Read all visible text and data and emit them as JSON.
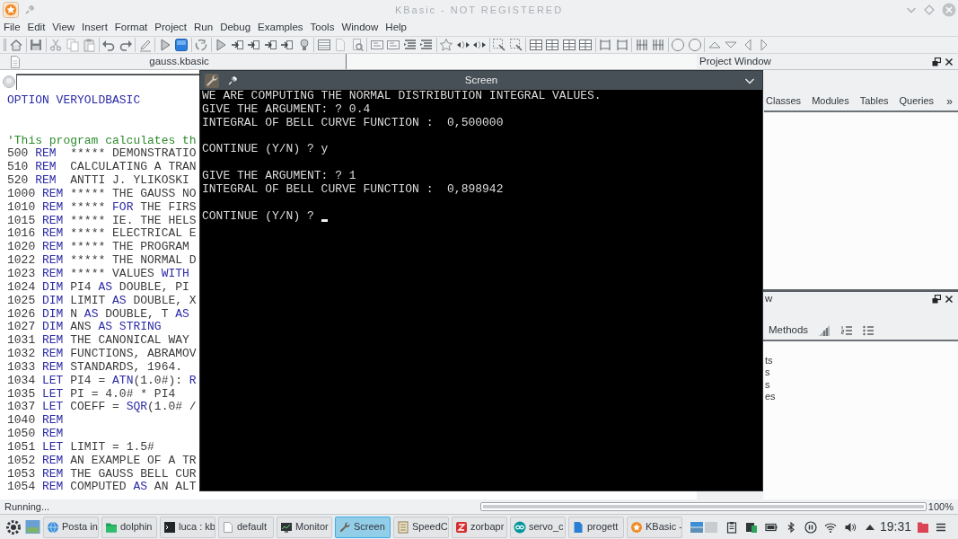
{
  "window": {
    "title": "KBasic - NOT REGISTERED"
  },
  "menu": [
    "File",
    "Edit",
    "View",
    "Insert",
    "Format",
    "Project",
    "Run",
    "Debug",
    "Examples",
    "Tools",
    "Window",
    "Help"
  ],
  "editor": {
    "tab": "gauss.kbasic",
    "lines": [
      {
        "kind": "code",
        "tokens": [
          {
            "kind": "keyword",
            "text": "OPTION VERYOLDBASIC"
          }
        ]
      },
      {
        "kind": "blank"
      },
      {
        "kind": "blank"
      },
      {
        "kind": "code",
        "tokens": [
          {
            "kind": "comment",
            "text": "'This program calculates th"
          }
        ]
      },
      {
        "kind": "code",
        "tokens": [
          {
            "kind": "text",
            "text": "500 "
          },
          {
            "kind": "keyword",
            "text": "REM"
          },
          {
            "kind": "text",
            "text": "  ***** DEMONSTRATIO"
          }
        ]
      },
      {
        "kind": "code",
        "tokens": [
          {
            "kind": "text",
            "text": "510 "
          },
          {
            "kind": "keyword",
            "text": "REM"
          },
          {
            "kind": "text",
            "text": "  CALCULATING A TRAN"
          }
        ]
      },
      {
        "kind": "code",
        "tokens": [
          {
            "kind": "text",
            "text": "520 "
          },
          {
            "kind": "keyword",
            "text": "REM"
          },
          {
            "kind": "text",
            "text": "  ANTTI J. YLIKOSKI"
          }
        ]
      },
      {
        "kind": "code",
        "tokens": [
          {
            "kind": "text",
            "text": "1000 "
          },
          {
            "kind": "keyword",
            "text": "REM"
          },
          {
            "kind": "text",
            "text": " ***** THE GAUSS NO"
          }
        ]
      },
      {
        "kind": "code",
        "tokens": [
          {
            "kind": "text",
            "text": "1010 "
          },
          {
            "kind": "keyword",
            "text": "REM"
          },
          {
            "kind": "text",
            "text": " ***** "
          },
          {
            "kind": "keyword",
            "text": "FOR"
          },
          {
            "kind": "text",
            "text": " THE FIRS"
          }
        ]
      },
      {
        "kind": "code",
        "tokens": [
          {
            "kind": "text",
            "text": "1015 "
          },
          {
            "kind": "keyword",
            "text": "REM"
          },
          {
            "kind": "text",
            "text": " ***** IE. THE HELS"
          }
        ]
      },
      {
        "kind": "code",
        "tokens": [
          {
            "kind": "text",
            "text": "1016 "
          },
          {
            "kind": "keyword",
            "text": "REM"
          },
          {
            "kind": "text",
            "text": " ***** ELECTRICAL E"
          }
        ]
      },
      {
        "kind": "code",
        "tokens": [
          {
            "kind": "text",
            "text": "1020 "
          },
          {
            "kind": "keyword",
            "text": "REM"
          },
          {
            "kind": "text",
            "text": " ***** THE PROGRAM"
          }
        ]
      },
      {
        "kind": "code",
        "tokens": [
          {
            "kind": "text",
            "text": "1022 "
          },
          {
            "kind": "keyword",
            "text": "REM"
          },
          {
            "kind": "text",
            "text": " ***** THE NORMAL D"
          }
        ]
      },
      {
        "kind": "code",
        "tokens": [
          {
            "kind": "text",
            "text": "1023 "
          },
          {
            "kind": "keyword",
            "text": "REM"
          },
          {
            "kind": "text",
            "text": " ***** VALUES "
          },
          {
            "kind": "keyword",
            "text": "WITH"
          }
        ]
      },
      {
        "kind": "code",
        "tokens": [
          {
            "kind": "text",
            "text": "1024 "
          },
          {
            "kind": "keyword",
            "text": "DIM"
          },
          {
            "kind": "text",
            "text": " PI4 "
          },
          {
            "kind": "keyword",
            "text": "AS"
          },
          {
            "kind": "text",
            "text": " DOUBLE, PI"
          }
        ]
      },
      {
        "kind": "code",
        "tokens": [
          {
            "kind": "text",
            "text": "1025 "
          },
          {
            "kind": "keyword",
            "text": "DIM"
          },
          {
            "kind": "text",
            "text": " LIMIT "
          },
          {
            "kind": "keyword",
            "text": "AS"
          },
          {
            "kind": "text",
            "text": " DOUBLE, X"
          }
        ]
      },
      {
        "kind": "code",
        "tokens": [
          {
            "kind": "text",
            "text": "1026 "
          },
          {
            "kind": "keyword",
            "text": "DIM"
          },
          {
            "kind": "text",
            "text": " N "
          },
          {
            "kind": "keyword",
            "text": "AS"
          },
          {
            "kind": "text",
            "text": " DOUBLE, T "
          },
          {
            "kind": "keyword",
            "text": "AS"
          }
        ]
      },
      {
        "kind": "code",
        "tokens": [
          {
            "kind": "text",
            "text": "1027 "
          },
          {
            "kind": "keyword",
            "text": "DIM"
          },
          {
            "kind": "text",
            "text": " ANS "
          },
          {
            "kind": "keyword",
            "text": "AS STRING"
          }
        ]
      },
      {
        "kind": "code",
        "tokens": [
          {
            "kind": "text",
            "text": "1031 "
          },
          {
            "kind": "keyword",
            "text": "REM"
          },
          {
            "kind": "text",
            "text": " THE CANONICAL WAY"
          }
        ]
      },
      {
        "kind": "code",
        "tokens": [
          {
            "kind": "text",
            "text": "1032 "
          },
          {
            "kind": "keyword",
            "text": "REM"
          },
          {
            "kind": "text",
            "text": " FUNCTIONS, ABRAMOV"
          }
        ]
      },
      {
        "kind": "code",
        "tokens": [
          {
            "kind": "text",
            "text": "1033 "
          },
          {
            "kind": "keyword",
            "text": "REM"
          },
          {
            "kind": "text",
            "text": " STANDARDS, 1964."
          }
        ]
      },
      {
        "kind": "code",
        "tokens": [
          {
            "kind": "text",
            "text": "1034 "
          },
          {
            "kind": "keyword",
            "text": "LET"
          },
          {
            "kind": "text",
            "text": " PI4 = "
          },
          {
            "kind": "keyword",
            "text": "ATN"
          },
          {
            "kind": "text",
            "text": "(1.0#): "
          },
          {
            "kind": "keyword",
            "text": "R"
          }
        ]
      },
      {
        "kind": "code",
        "tokens": [
          {
            "kind": "text",
            "text": "1035 "
          },
          {
            "kind": "keyword",
            "text": "LET"
          },
          {
            "kind": "text",
            "text": " PI = 4.0# * PI4"
          }
        ]
      },
      {
        "kind": "code",
        "tokens": [
          {
            "kind": "text",
            "text": "1037 "
          },
          {
            "kind": "keyword",
            "text": "LET"
          },
          {
            "kind": "text",
            "text": " COEFF = "
          },
          {
            "kind": "keyword",
            "text": "SQR"
          },
          {
            "kind": "text",
            "text": "(1.0# /"
          }
        ]
      },
      {
        "kind": "code",
        "tokens": [
          {
            "kind": "text",
            "text": "1040 "
          },
          {
            "kind": "keyword",
            "text": "REM"
          }
        ]
      },
      {
        "kind": "code",
        "tokens": [
          {
            "kind": "text",
            "text": "1050 "
          },
          {
            "kind": "keyword",
            "text": "REM"
          }
        ]
      },
      {
        "kind": "code",
        "tokens": [
          {
            "kind": "text",
            "text": "1051 "
          },
          {
            "kind": "keyword",
            "text": "LET"
          },
          {
            "kind": "text",
            "text": " LIMIT = 1.5#"
          }
        ]
      },
      {
        "kind": "code",
        "tokens": [
          {
            "kind": "text",
            "text": "1052 "
          },
          {
            "kind": "keyword",
            "text": "REM"
          },
          {
            "kind": "text",
            "text": " AN EXAMPLE OF A TR"
          }
        ]
      },
      {
        "kind": "code",
        "tokens": [
          {
            "kind": "text",
            "text": "1053 "
          },
          {
            "kind": "keyword",
            "text": "REM"
          },
          {
            "kind": "text",
            "text": " THE GAUSS BELL CUR"
          }
        ]
      },
      {
        "kind": "code",
        "tokens": [
          {
            "kind": "text",
            "text": "1054 "
          },
          {
            "kind": "keyword",
            "text": "REM"
          },
          {
            "kind": "text",
            "text": " COMPUTED "
          },
          {
            "kind": "keyword",
            "text": "AS"
          },
          {
            "kind": "text",
            "text": " AN ALT"
          }
        ]
      }
    ]
  },
  "screen_window": {
    "title": "Screen",
    "lines": [
      {
        "kind": "text",
        "text": "WE ARE COMPUTING THE NORMAL DISTRIBUTION INTEGRAL VALUES."
      },
      {
        "kind": "text",
        "text": "GIVE THE ARGUMENT: ? 0.4"
      },
      {
        "kind": "text",
        "text": "INTEGRAL OF BELL CURVE FUNCTION :  0,500000"
      },
      {
        "kind": "blank"
      },
      {
        "kind": "text",
        "text": "CONTINUE (Y/N) ? y"
      },
      {
        "kind": "blank"
      },
      {
        "kind": "text",
        "text": "GIVE THE ARGUMENT: ? 1"
      },
      {
        "kind": "text",
        "text": "INTEGRAL OF BELL CURVE FUNCTION :  0,898942"
      },
      {
        "kind": "blank"
      },
      {
        "kind": "text",
        "text": "CONTINUE (Y/N) ?"
      }
    ],
    "cursor_visible": true
  },
  "project_window": {
    "title": "Project Window",
    "tabs": [
      {
        "label": "Classes",
        "selected": false
      },
      {
        "label": "Modules",
        "selected": false
      },
      {
        "label": "Tables",
        "selected": false
      },
      {
        "label": "Queries",
        "selected": false
      }
    ],
    "more": "»"
  },
  "lower_dock": {
    "title": "w",
    "toolbar_label": "Methods",
    "items": [
      "ts",
      "s",
      "s",
      "es"
    ]
  },
  "status_bar": {
    "text": "Running...",
    "level": 1,
    "reading": "100%"
  },
  "taskbar": {
    "tasks": [
      {
        "label": "Posta in",
        "selected": false
      },
      {
        "label": "dolphin",
        "selected": false
      },
      {
        "label": "luca : kb",
        "selected": false
      },
      {
        "label": "default",
        "selected": false
      },
      {
        "label": "Monitor",
        "selected": false
      },
      {
        "label": "Screen",
        "selected": true
      },
      {
        "label": "SpeedC",
        "selected": false
      },
      {
        "label": "zorbapr",
        "selected": false
      },
      {
        "label": "servo_c",
        "selected": false
      },
      {
        "label": "progett",
        "selected": false
      },
      {
        "label": "KBasic -",
        "selected": false
      }
    ],
    "clock": "19:31"
  }
}
